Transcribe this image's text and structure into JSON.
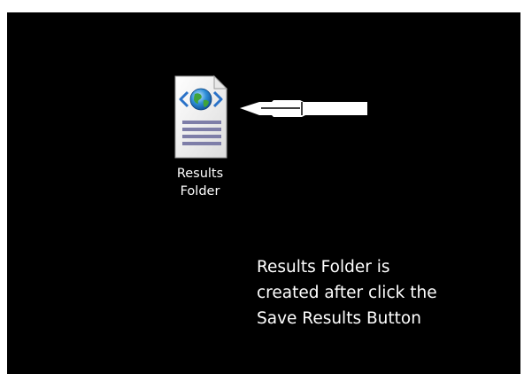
{
  "desktop": {
    "background": "#000000",
    "icon": {
      "type": "html-document-icon",
      "label_lines": [
        "Results",
        "Folder"
      ]
    }
  },
  "annotation": {
    "arrow_color": "#ffffff",
    "caption_lines": [
      "Results Folder is",
      "created after click the",
      "Save Results Button"
    ]
  }
}
